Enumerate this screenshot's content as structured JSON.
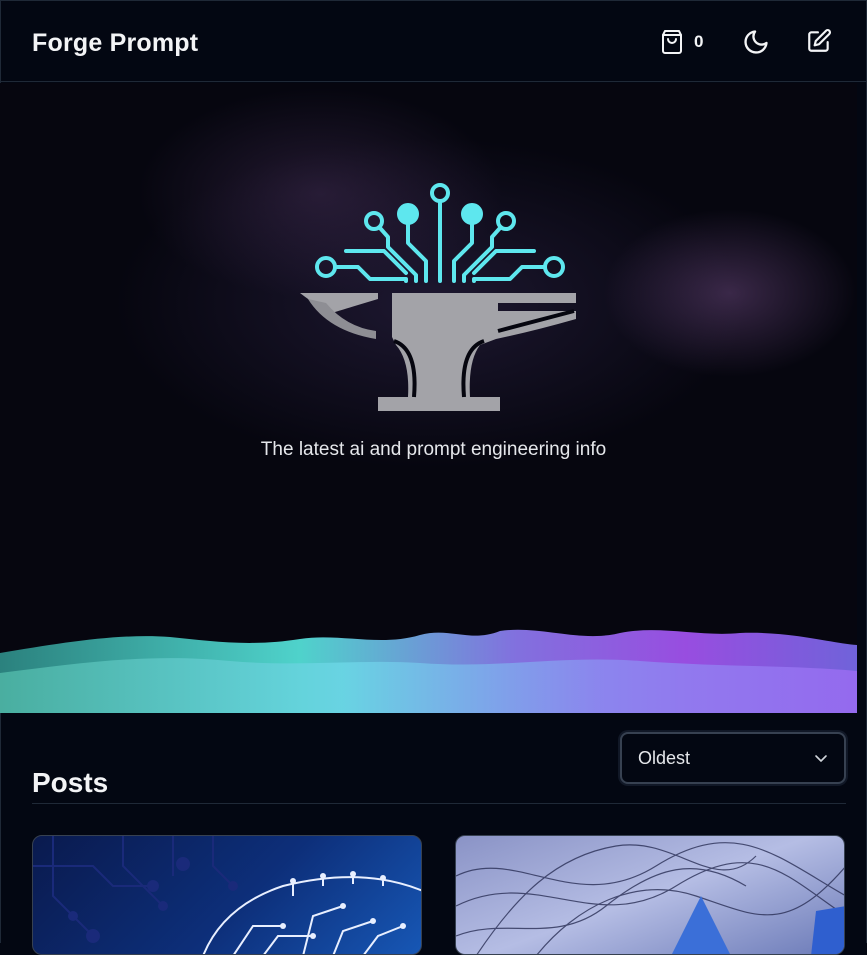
{
  "header": {
    "brand": "Forge Prompt",
    "cart_count": "0",
    "cart_icon": "shopping-bag-icon",
    "theme_icon": "moon-icon",
    "write_icon": "edit-icon"
  },
  "hero": {
    "logo": "anvil-circuit-logo",
    "tagline": "The latest ai and prompt engineering info"
  },
  "posts": {
    "title": "Posts",
    "sort": {
      "selected": "Oldest"
    },
    "cards": [
      {
        "image": "circuit-brain-image"
      },
      {
        "image": "abstract-lines-image"
      }
    ]
  },
  "colors": {
    "background": "#030712",
    "accent_cyan": "#5ee7ee",
    "anvil_gray": "#a3a3a8"
  }
}
